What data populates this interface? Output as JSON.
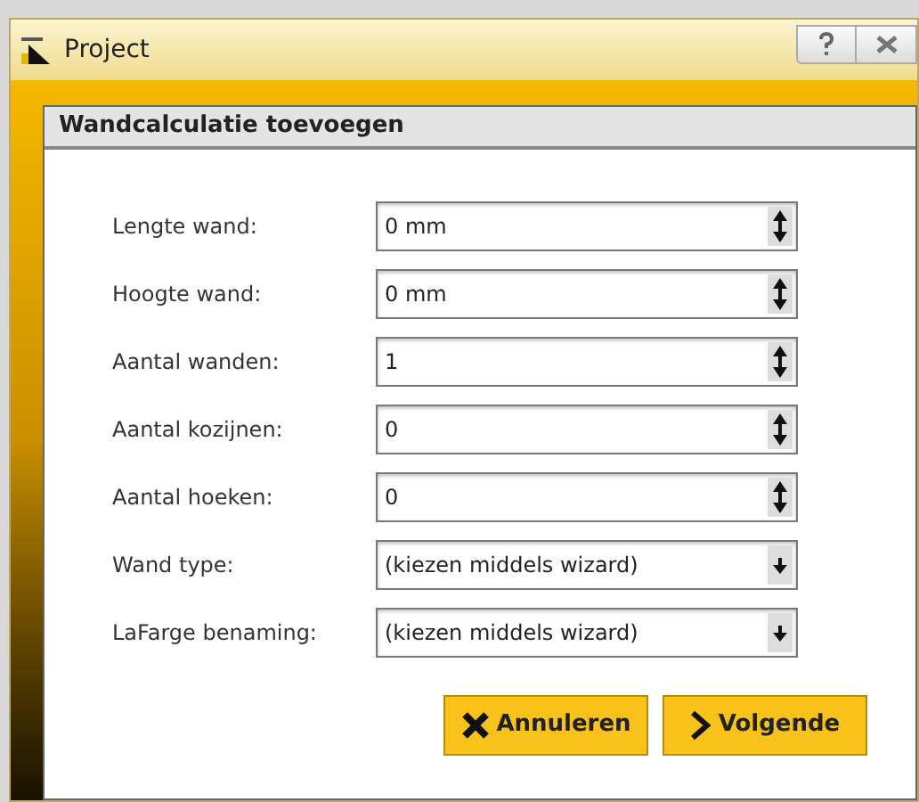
{
  "window": {
    "title": "Project"
  },
  "panel": {
    "title": "Wandcalculatie toevoegen"
  },
  "fields": [
    {
      "label": "Lengte wand:",
      "value": "0 mm",
      "kind": "spinner"
    },
    {
      "label": "Hoogte wand:",
      "value": "0 mm",
      "kind": "spinner"
    },
    {
      "label": "Aantal wanden:",
      "value": "1",
      "kind": "spinner"
    },
    {
      "label": "Aantal kozijnen:",
      "value": "0",
      "kind": "spinner"
    },
    {
      "label": "Aantal hoeken:",
      "value": "0",
      "kind": "spinner"
    },
    {
      "label": "Wand type:",
      "value": "(kiezen middels wizard)",
      "kind": "dropdown"
    },
    {
      "label": "LaFarge benaming:",
      "value": "(kiezen middels wizard)",
      "kind": "dropdown"
    }
  ],
  "buttons": [
    {
      "label": "Annuleren",
      "kind": "cancel"
    },
    {
      "label": "Volgende",
      "kind": "next"
    }
  ]
}
